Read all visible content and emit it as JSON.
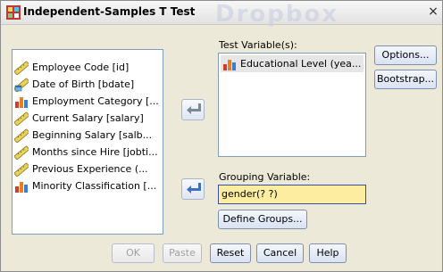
{
  "window": {
    "title": "Independent-Samples T Test",
    "close": "×"
  },
  "watermark": "Dropbox",
  "source_list": {
    "items": [
      {
        "label": "Employee Code [id]",
        "icon": "scale-ruler-icon"
      },
      {
        "label": "Date of Birth [bdate]",
        "icon": "date-ruler-icon"
      },
      {
        "label": "Employment Category [...",
        "icon": "nominal-bars-icon"
      },
      {
        "label": "Current Salary [salary]",
        "icon": "scale-ruler-icon"
      },
      {
        "label": "Beginning Salary [salb...",
        "icon": "scale-ruler-icon"
      },
      {
        "label": "Months since Hire [jobti...",
        "icon": "scale-ruler-icon"
      },
      {
        "label": "Previous Experience (...",
        "icon": "scale-ruler-icon"
      },
      {
        "label": "Minority Classification [...",
        "icon": "nominal-bars-icon"
      }
    ]
  },
  "test_variables": {
    "label": "Test Variable(s):",
    "items": [
      {
        "label": "Educational Level (yea...",
        "icon": "nominal-bars-icon"
      }
    ]
  },
  "grouping": {
    "label": "Grouping Variable:",
    "value": "gender(? ?)"
  },
  "buttons": {
    "options": "Options...",
    "bootstrap": "Bootstrap...",
    "define_groups": "Define Groups...",
    "ok": "OK",
    "paste": "Paste",
    "reset": "Reset",
    "cancel": "Cancel",
    "help": "Help"
  },
  "colors": {
    "accent": "#3a4da8",
    "grouping_bg": "#fdeda1",
    "dialog_bg": "#ece9d8"
  }
}
